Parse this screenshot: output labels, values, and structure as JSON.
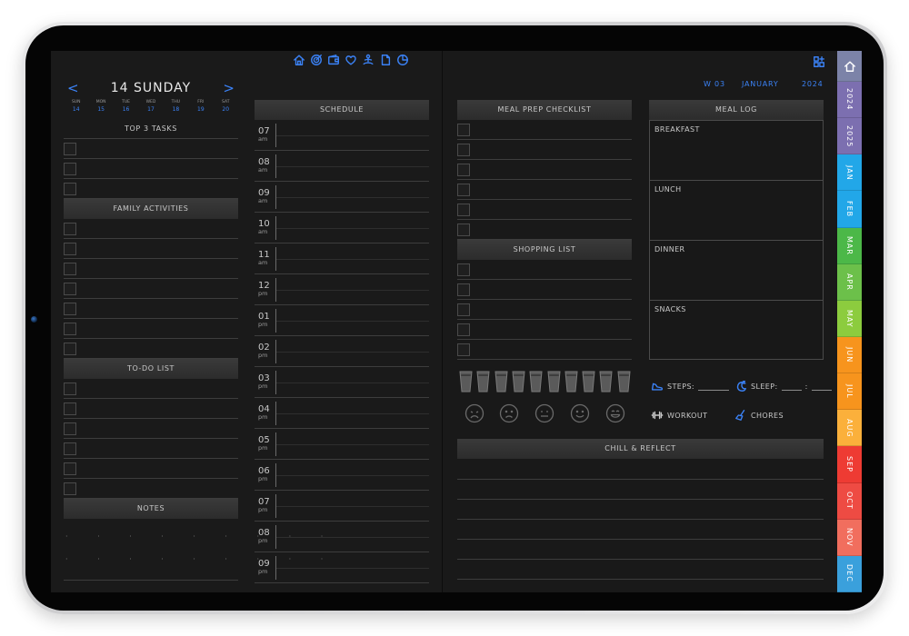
{
  "top_icons": [
    "home-icon",
    "target-icon",
    "wallet-icon",
    "heart-icon",
    "meditation-icon",
    "document-icon",
    "pie-chart-icon"
  ],
  "day_title": "14 SUNDAY",
  "prev_arrow": "<",
  "next_arrow": ">",
  "week": {
    "day_names": [
      "SUN",
      "MON",
      "TUE",
      "WED",
      "THU",
      "FRI",
      "SAT"
    ],
    "dates": [
      "14",
      "15",
      "16",
      "17",
      "18",
      "19",
      "20"
    ]
  },
  "sections": {
    "top3": "TOP 3 TASKS",
    "family": "FAMILY ACTIVITIES",
    "todo": "TO-DO LIST",
    "notes": "NOTES",
    "schedule": "SCHEDULE",
    "meal_prep": "MEAL PREP CHECKLIST",
    "shopping": "SHOPPING LIST",
    "meal_log": "MEAL LOG",
    "chill": "CHILL & REFLECT"
  },
  "schedule_times": [
    {
      "hour": "07",
      "ap": "am"
    },
    {
      "hour": "08",
      "ap": "am"
    },
    {
      "hour": "09",
      "ap": "am"
    },
    {
      "hour": "10",
      "ap": "am"
    },
    {
      "hour": "11",
      "ap": "am"
    },
    {
      "hour": "12",
      "ap": "pm"
    },
    {
      "hour": "01",
      "ap": "pm"
    },
    {
      "hour": "02",
      "ap": "pm"
    },
    {
      "hour": "03",
      "ap": "pm"
    },
    {
      "hour": "04",
      "ap": "pm"
    },
    {
      "hour": "05",
      "ap": "pm"
    },
    {
      "hour": "06",
      "ap": "pm"
    },
    {
      "hour": "07",
      "ap": "pm"
    },
    {
      "hour": "08",
      "ap": "pm"
    },
    {
      "hour": "09",
      "ap": "pm"
    }
  ],
  "header_right": {
    "week": "W 03",
    "month": "JANUARY",
    "year": "2024"
  },
  "meal_log": [
    "BREAKFAST",
    "LUNCH",
    "DINNER",
    "SNACKS"
  ],
  "stats": {
    "steps": "STEPS:",
    "sleep": "SLEEP:",
    "sleep_sep": ":",
    "workout": "WORKOUT",
    "chores": "CHORES"
  },
  "tabs": [
    {
      "label": "2024",
      "color": "#7c6fb0"
    },
    {
      "label": "2025",
      "color": "#7c6fb0"
    },
    {
      "label": "JAN",
      "color": "#22a7e8"
    },
    {
      "label": "FEB",
      "color": "#22a7e8"
    },
    {
      "label": "MAR",
      "color": "#4cb848"
    },
    {
      "label": "APR",
      "color": "#6cc04a"
    },
    {
      "label": "MAY",
      "color": "#8ccc3e"
    },
    {
      "label": "JUN",
      "color": "#f7941d"
    },
    {
      "label": "JUL",
      "color": "#f7941d"
    },
    {
      "label": "AUG",
      "color": "#fbb03b"
    },
    {
      "label": "SEP",
      "color": "#ee3b33"
    },
    {
      "label": "OCT",
      "color": "#ee4b43"
    },
    {
      "label": "NOV",
      "color": "#f16e5e"
    },
    {
      "label": "DEC",
      "color": "#3aa0dc"
    }
  ],
  "home_tab_color": "#7c83a8",
  "accent_color": "#3b82f6"
}
